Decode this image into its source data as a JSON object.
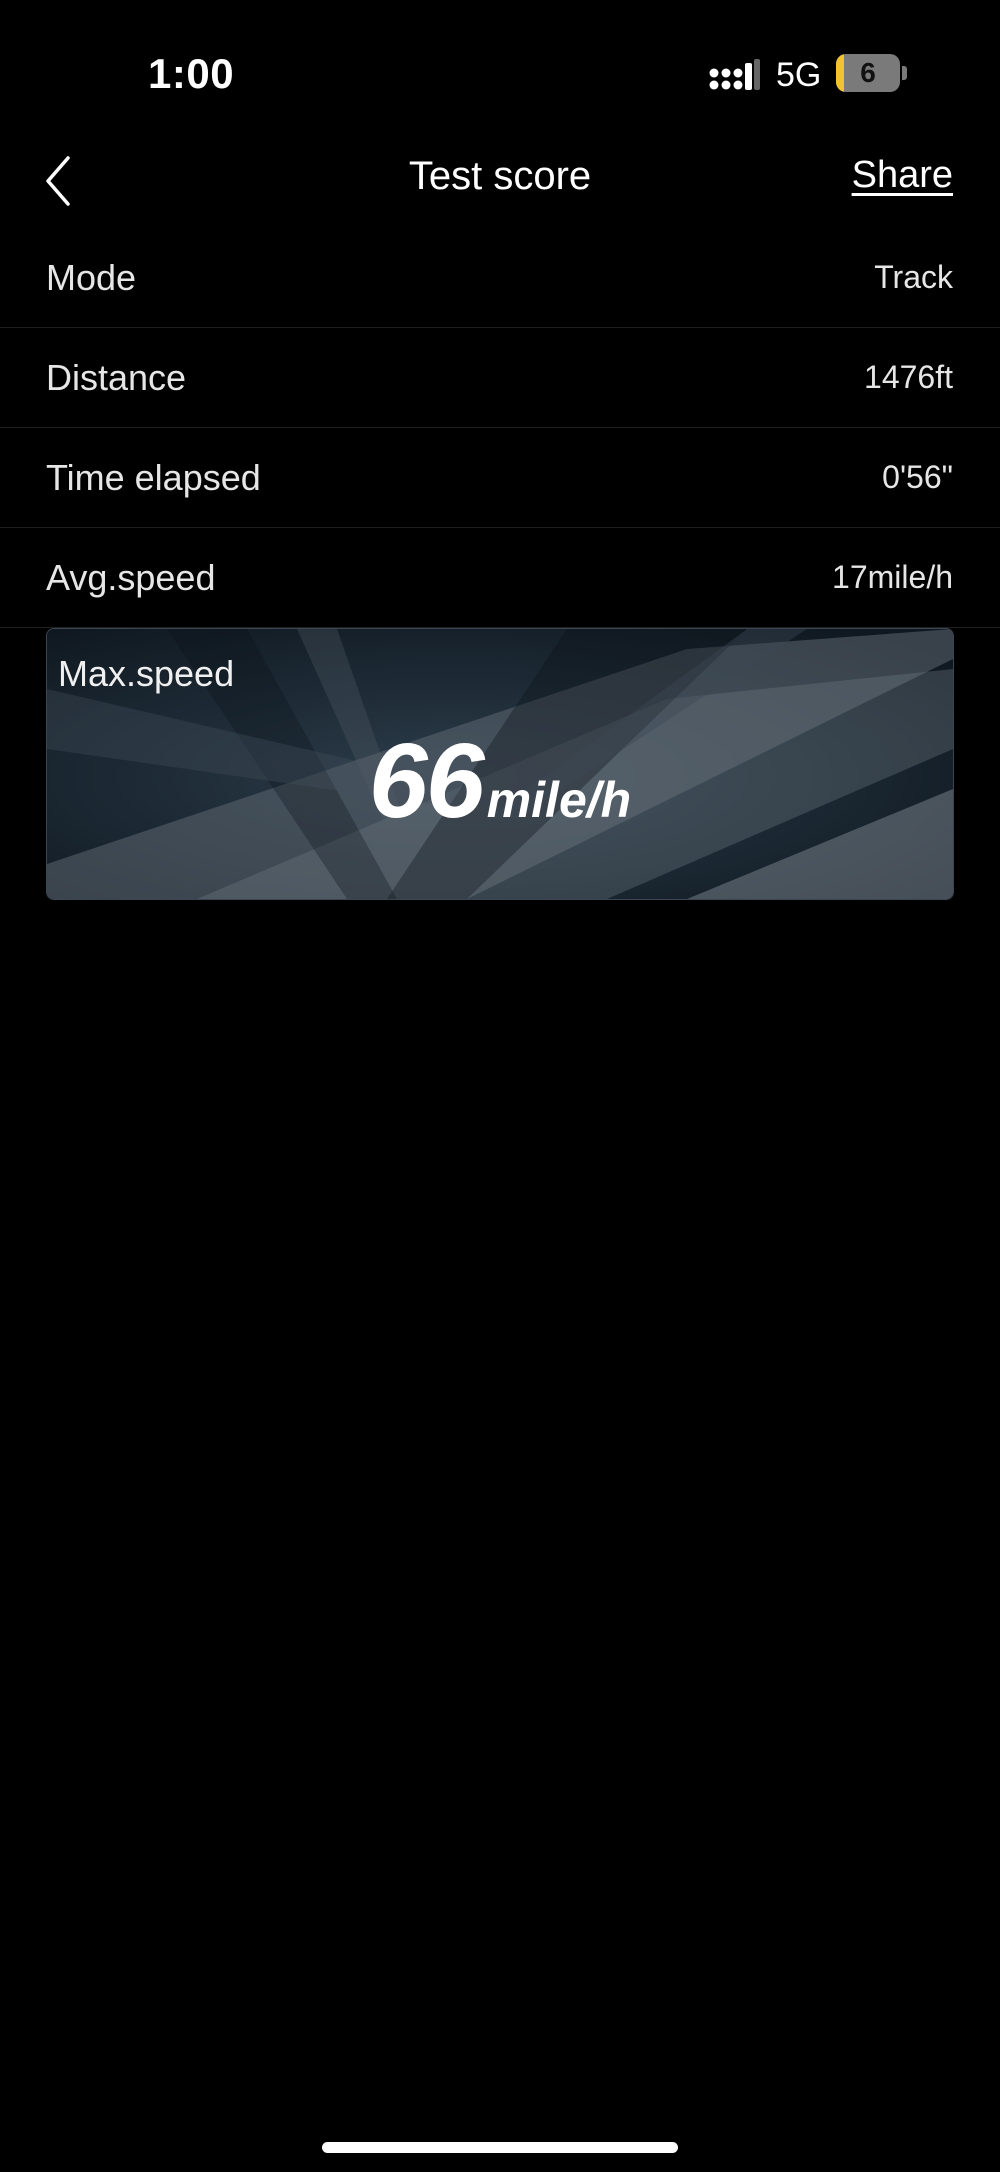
{
  "status_bar": {
    "time": "1:00",
    "network": "5G",
    "battery_level": "6",
    "icons": [
      "signal-icon",
      "battery-icon"
    ]
  },
  "nav": {
    "title": "Test score",
    "share_label": "Share",
    "back_icon": "chevron-left-icon"
  },
  "stats": [
    {
      "label": "Mode",
      "value": "Track"
    },
    {
      "label": "Distance",
      "value": "1476ft"
    },
    {
      "label": "Time elapsed",
      "value": "0'56\""
    },
    {
      "label": "Avg.speed",
      "value": "17mile/h"
    }
  ],
  "max_speed": {
    "label": "Max.speed",
    "value": "66",
    "unit": "mile/h"
  },
  "colors": {
    "background": "#000000",
    "card_background": "#17222c",
    "battery_accent": "#f2c230"
  }
}
